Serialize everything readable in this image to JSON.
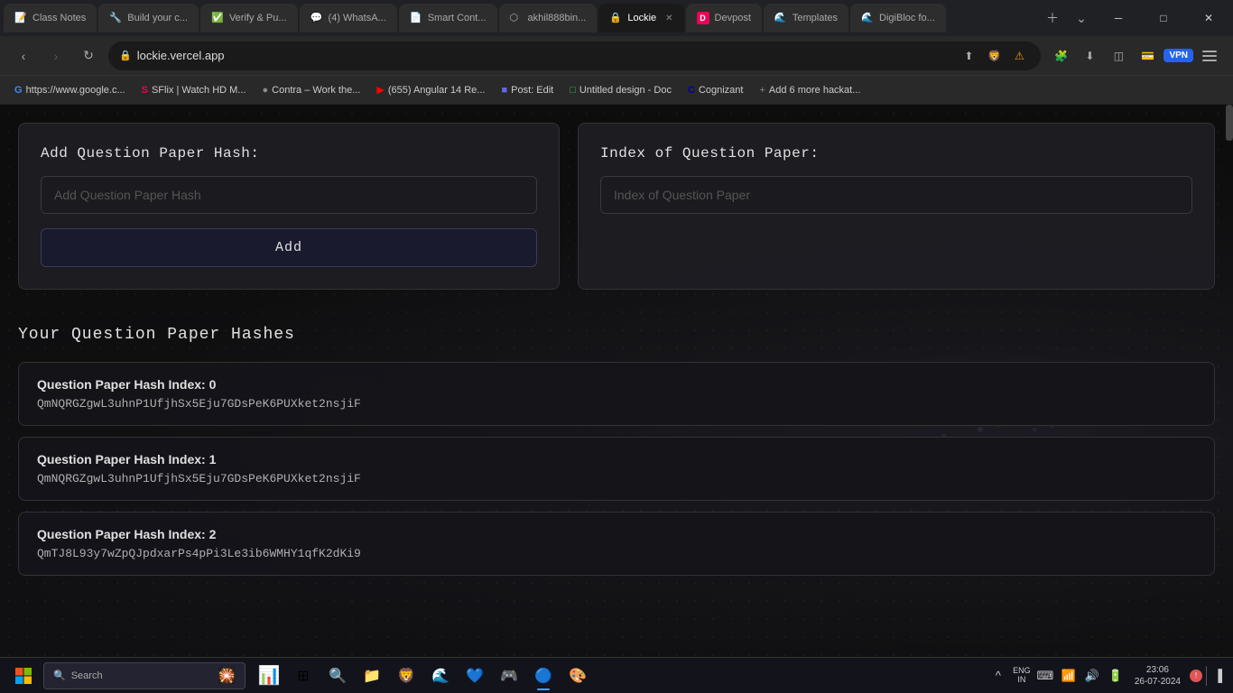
{
  "browser": {
    "tabs": [
      {
        "id": "class-notes",
        "label": "Class Notes",
        "favicon": "📝",
        "active": false
      },
      {
        "id": "build-your",
        "label": "Build your c...",
        "favicon": "🔧",
        "active": false
      },
      {
        "id": "verify-pu",
        "label": "Verify & Pu...",
        "favicon": "✅",
        "active": false
      },
      {
        "id": "whatsapp",
        "label": "(4) WhatsA...",
        "favicon": "💬",
        "active": false
      },
      {
        "id": "smart-cont",
        "label": "Smart Cont...",
        "favicon": "📄",
        "active": false
      },
      {
        "id": "akhil888bin",
        "label": "akhil888bin...",
        "favicon": "⬡",
        "active": false
      },
      {
        "id": "lockie",
        "label": "Lockie",
        "favicon": "🔒",
        "active": true
      },
      {
        "id": "devpost",
        "label": "Devpost",
        "favicon": "🅳",
        "active": false
      },
      {
        "id": "templates",
        "label": "Templates",
        "favicon": "🌊",
        "active": false
      },
      {
        "id": "digibloc",
        "label": "DigiBloc fo...",
        "favicon": "🌊",
        "active": false
      }
    ],
    "url": "lockie.vercel.app",
    "bookmarks": [
      {
        "label": "https://www.google.c...",
        "favicon": "G"
      },
      {
        "label": "SFlix | Watch HD M...",
        "favicon": "S"
      },
      {
        "label": "Contra – Work the...",
        "favicon": "C"
      },
      {
        "label": "(655) Angular 14 Re...",
        "favicon": "▶"
      },
      {
        "label": "Post: Edit",
        "favicon": "P"
      },
      {
        "label": "Untitled design - Doc",
        "favicon": "U"
      },
      {
        "label": "Cognizant",
        "favicon": "C"
      },
      {
        "label": "Add 6 more hackat...",
        "favicon": "+"
      }
    ]
  },
  "page": {
    "add_section": {
      "title": "Add Question Paper Hash:",
      "input_placeholder": "Add Question Paper Hash",
      "button_label": "Add"
    },
    "index_section": {
      "title": "Index of Question Paper:",
      "input_placeholder": "Index of Question Paper"
    },
    "hashes_section": {
      "title": "Your Question Paper Hashes",
      "items": [
        {
          "index_label": "Question Paper Hash Index: 0",
          "hash": "QmNQRGZgwL3uhnP1UfjhSx5Eju7GDsPeK6PUXket2nsjiF"
        },
        {
          "index_label": "Question Paper Hash Index: 1",
          "hash": "QmNQRGZgwL3uhnP1UfjhSx5Eju7GDsPeK6PUXket2nsjiF"
        },
        {
          "index_label": "Question Paper Hash Index: 2",
          "hash": "QmTJ8L93y7wZpQJpdxarPs4pPi3Le3ib6WMHY1qfK2dKi9"
        }
      ]
    }
  },
  "taskbar": {
    "search_placeholder": "Search",
    "time": "23:06",
    "date": "26-07-2024",
    "language": "ENG",
    "region": "IN"
  }
}
